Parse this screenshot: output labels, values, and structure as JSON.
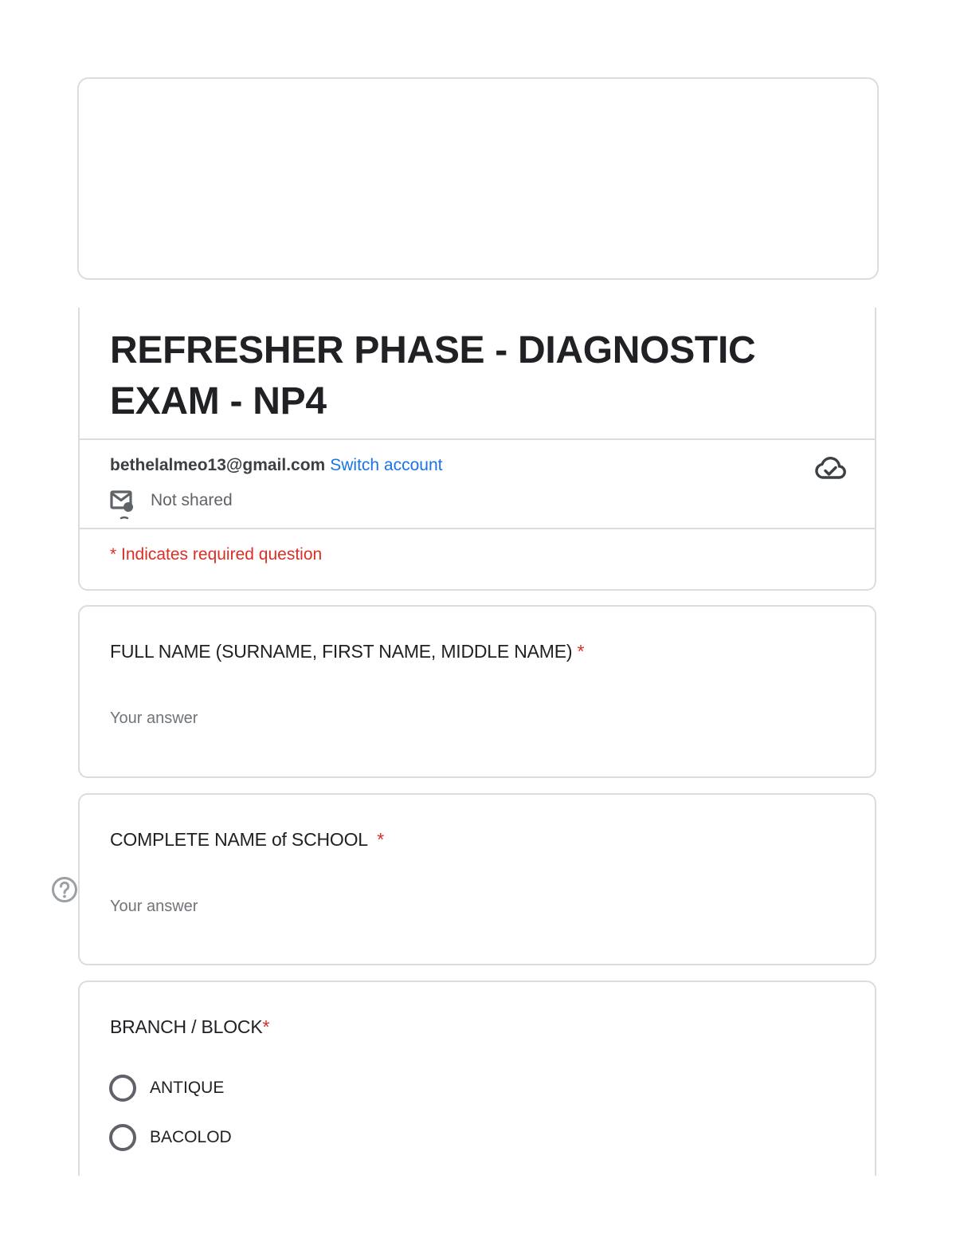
{
  "form": {
    "title": "REFRESHER PHASE - DIAGNOSTIC EXAM - NP4",
    "account": {
      "email": "bethelalmeo13@gmail.com",
      "switch_label": "Switch account",
      "shared_status": "Not shared"
    },
    "required_note": "* Indicates required question"
  },
  "questions": [
    {
      "title": "FULL NAME (SURNAME, FIRST NAME, MIDDLE NAME)",
      "required_mark": "*",
      "placeholder": "Your answer"
    },
    {
      "title": "COMPLETE NAME of SCHOOL",
      "required_mark": "*",
      "placeholder": "Your answer"
    },
    {
      "title": "BRANCH / BLOCK",
      "required_mark": "*",
      "options": [
        "ANTIQUE",
        "BACOLOD"
      ]
    }
  ],
  "icons": {
    "cloud": "cloud-saved-icon",
    "shared": "email-not-shared-icon",
    "help": "help-icon"
  },
  "colors": {
    "accent_link": "#1a73e8",
    "required": "#d93025",
    "border": "#dadce0"
  }
}
